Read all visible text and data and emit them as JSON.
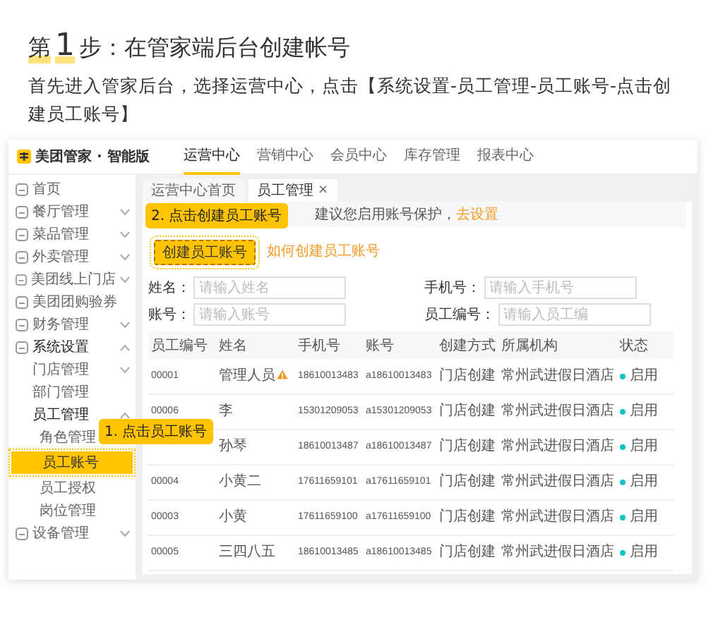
{
  "step": {
    "label": "第",
    "number": "1",
    "title": "步：在管家端后台创建帐号"
  },
  "intro": "首先进入管家后台，选择运营中心，点击【系统设置-员工管理-员工账号-点击创建员工账号】",
  "app": {
    "logo": "美团管家 · 智能版",
    "nav": [
      {
        "label": "运营中心",
        "selected": true
      },
      {
        "label": "营销中心",
        "selected": false
      },
      {
        "label": "会员中心",
        "selected": false
      },
      {
        "label": "库存管理",
        "selected": false
      },
      {
        "label": "报表中心",
        "selected": false
      }
    ],
    "sidebar": [
      {
        "label": "首页",
        "selected": false
      },
      {
        "label": "餐厅管理",
        "selected": false,
        "expanded": false
      },
      {
        "label": "菜品管理",
        "selected": false,
        "expanded": false
      },
      {
        "label": "外卖管理",
        "selected": false,
        "expanded": false
      },
      {
        "label": "美团线上门店",
        "selected": false,
        "expanded": false
      },
      {
        "label": "美团团购验券",
        "selected": false
      },
      {
        "label": "财务管理",
        "selected": false,
        "expanded": false
      },
      {
        "label": "系统设置",
        "selected": false,
        "expanded": true,
        "children": [
          {
            "label": "门店管理",
            "selected": false,
            "expanded": false
          },
          {
            "label": "部门管理",
            "selected": false
          },
          {
            "label": "员工管理",
            "selected": false,
            "expanded": true,
            "children": [
              {
                "label": "角色管理",
                "selected": false
              },
              {
                "label": "员工账号",
                "selected": true,
                "callout": "1. 点击员工账号"
              },
              {
                "label": "员工授权",
                "selected": false
              },
              {
                "label": "岗位管理",
                "selected": false
              }
            ]
          }
        ]
      },
      {
        "label": "设备管理",
        "selected": false,
        "expanded": false
      }
    ],
    "tabs": [
      {
        "label": "运营中心首页",
        "selected": false
      },
      {
        "label": "员工管理",
        "selected": true,
        "close": "×"
      }
    ],
    "notice": {
      "text": "建议您启用账号保护，",
      "link": "去设置"
    },
    "create_button": {
      "label": "创建员工账号",
      "highlighted": true,
      "callout": "2. 点击创建员工账号"
    },
    "help_link": "如何创建员工账号",
    "filters": [
      {
        "label": "姓名：",
        "placeholder": "请输入姓名"
      },
      {
        "label": "手机号：",
        "placeholder": "请输入手机号"
      },
      {
        "label": "账号：",
        "placeholder": "请输入账号"
      },
      {
        "label": "员工编号：",
        "placeholder": "请输入员工编"
      }
    ],
    "table": {
      "columns": [
        "员工编号",
        "姓名",
        "手机号",
        "账号",
        "创建方式",
        "所属机构",
        "状态"
      ],
      "rows": [
        {
          "id": "00001",
          "name": "管理人员",
          "flagged": true,
          "phone": "18610013483",
          "account": "a18610013483",
          "method": "门店创建",
          "org": "常州武进假日酒店",
          "status": "启用"
        },
        {
          "id": "00006",
          "name": "李",
          "flagged": false,
          "phone": "15301209053",
          "account": "a15301209053",
          "method": "门店创建",
          "org": "常州武进假日酒店",
          "status": "启用"
        },
        {
          "name": "孙琴",
          "flagged": false,
          "phone": "18610013487",
          "account": "a18610013487",
          "method": "门店创建",
          "org": "常州武进假日酒店",
          "status": "启用"
        },
        {
          "id": "00004",
          "name": "小黄二",
          "flagged": false,
          "phone": "17611659101",
          "account": "a17611659101",
          "method": "门店创建",
          "org": "常州武进假日酒店",
          "status": "启用"
        },
        {
          "id": "00003",
          "name": "小黄",
          "flagged": false,
          "phone": "17611659100",
          "account": "a17611659100",
          "method": "门店创建",
          "org": "常州武进假日酒店",
          "status": "启用"
        },
        {
          "id": "00005",
          "name": "三四八五",
          "flagged": false,
          "phone": "18610013485",
          "account": "a18610013485",
          "method": "门店创建",
          "org": "常州武进假日酒店",
          "status": "启用"
        }
      ]
    }
  }
}
